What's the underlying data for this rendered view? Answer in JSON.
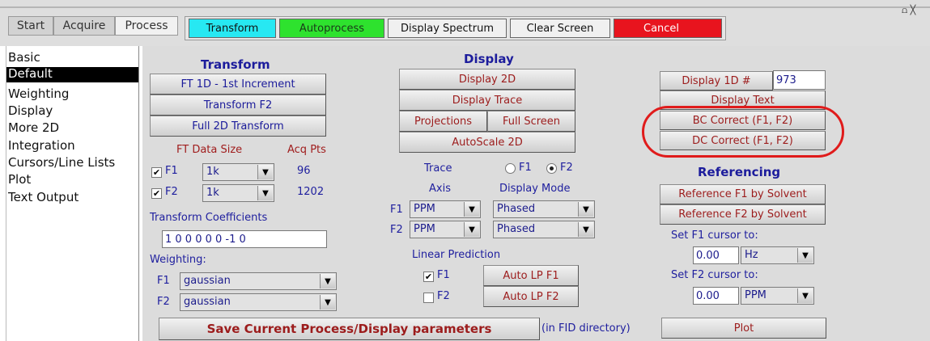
{
  "tabs": [
    "Start",
    "Acquire",
    "Process"
  ],
  "top_buttons": {
    "transform": "Transform",
    "autoprocess": "Autoprocess",
    "display_spectrum": "Display Spectrum",
    "clear_screen": "Clear Screen",
    "cancel": "Cancel"
  },
  "corner_glyphs": "⩍ ╳",
  "sidebar": [
    "Basic",
    "Default",
    "Weighting",
    "Display",
    "More 2D",
    "Integration",
    "Cursors/Line Lists",
    "Plot",
    "Text Output"
  ],
  "transform": {
    "heading": "Transform",
    "ft1d": "FT 1D - 1st Increment",
    "transform_f2": "Transform F2",
    "full_2d": "Full 2D Transform",
    "ft_data_size_label": "FT Data Size",
    "acq_pts_label": "Acq Pts",
    "f1_label": "F1",
    "f1_size": "1k",
    "f1_acq": "96",
    "f2_label": "F2",
    "f2_size": "1k",
    "f2_acq": "1202",
    "coeff_label": "Transform Coefficients",
    "coeff_value": "1 0 0 0 0 0 -1 0",
    "weighting_label": "Weighting:",
    "w_f1_label": "F1",
    "w_f1_value": "gaussian",
    "w_f2_label": "F2",
    "w_f2_value": "gaussian"
  },
  "display": {
    "heading": "Display",
    "display_2d": "Display 2D",
    "display_trace": "Display Trace",
    "projections": "Projections",
    "full_screen": "Full Screen",
    "autoscale_2d": "AutoScale 2D",
    "trace_label": "Trace",
    "trace_f1": "F1",
    "trace_f2": "F2",
    "trace_selected": "F2",
    "axis_label": "Axis",
    "display_mode_label": "Display Mode",
    "f1_label": "F1",
    "f1_axis": "PPM",
    "f1_mode": "Phased",
    "f2_label": "F2",
    "f2_axis": "PPM",
    "f2_mode": "Phased",
    "lp_label": "Linear Prediction",
    "lp_f1": "F1",
    "lp_f2": "F2",
    "auto_lp_f1": "Auto LP  F1",
    "auto_lp_f2": "Auto LP  F2"
  },
  "right": {
    "display_1d": "Display 1D #",
    "display_1d_value": "973",
    "display_text": "Display Text",
    "bc_correct": "BC Correct (F1, F2)",
    "dc_correct": "DC Correct (F1, F2)",
    "referencing_heading": "Referencing",
    "ref_f1": "Reference F1 by Solvent",
    "ref_f2": "Reference F2 by Solvent",
    "set_f1_label": "Set F1 cursor to:",
    "f1_cursor_value": "0.00",
    "f1_cursor_unit": "Hz",
    "set_f2_label": "Set F2 cursor to:",
    "f2_cursor_value": "0.00",
    "f2_cursor_unit": "PPM",
    "plot": "Plot"
  },
  "bottom": {
    "save": "Save Current Process/Display parameters",
    "save_note": "(in FID directory)"
  },
  "colors": {
    "transform_btn": "#27e8f2",
    "autoprocess_btn": "#2ee22e",
    "cancel_btn": "#e8141e",
    "highlight_circle": "#e01b1b",
    "selected_sidebar": "#000000"
  }
}
